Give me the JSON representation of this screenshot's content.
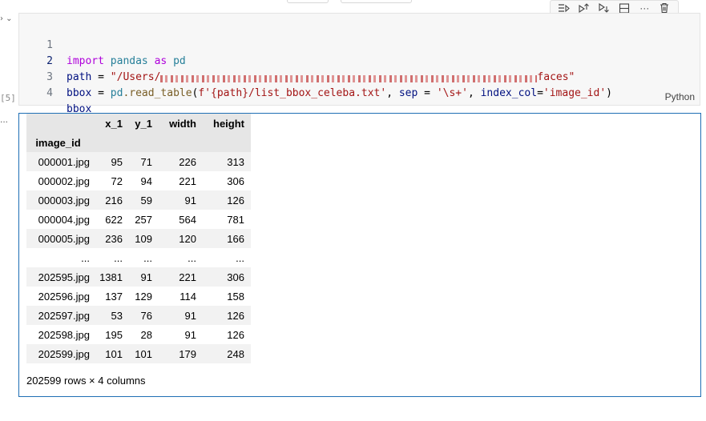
{
  "gutter": {
    "chevrons": "› ⌄",
    "execution_count": "[5]",
    "output_indicator": "..."
  },
  "cell_toolbar": {
    "icons": [
      "run-by-line-icon",
      "execute-above-icon",
      "execute-below-icon",
      "split-cell-icon",
      "more-icon",
      "delete-icon"
    ],
    "more_label": "···"
  },
  "code_cell": {
    "language": "Python",
    "lines": [
      {
        "number": "1",
        "import_kw": "import",
        "module": "pandas",
        "as_kw": "as",
        "alias": "pd"
      },
      {
        "number": "2",
        "var": "path",
        "op": " = ",
        "str_start": "\"/Users/",
        "str_end": "faces\""
      },
      {
        "number": "3",
        "var": "bbox",
        "op": " = ",
        "mod": "pd",
        "fn": ".read_table",
        "paren_open": "(",
        "fstr": "f'{path}/list_bbox_celeba.txt'",
        "sep_txt": ", ",
        "sep_kw": "sep",
        "sep_eq": " = ",
        "sep_val": "'\\s+'",
        "comma2": ", ",
        "index_kw": "index_col",
        "index_eq": "=",
        "index_val": "'image_id'",
        "paren_close": ")"
      },
      {
        "number": "4",
        "var": "bbox"
      }
    ]
  },
  "dataframe": {
    "index_name": "image_id",
    "columns": [
      "x_1",
      "y_1",
      "width",
      "height"
    ],
    "rows": [
      {
        "index": "000001.jpg",
        "values": [
          "95",
          "71",
          "226",
          "313"
        ]
      },
      {
        "index": "000002.jpg",
        "values": [
          "72",
          "94",
          "221",
          "306"
        ]
      },
      {
        "index": "000003.jpg",
        "values": [
          "216",
          "59",
          "91",
          "126"
        ]
      },
      {
        "index": "000004.jpg",
        "values": [
          "622",
          "257",
          "564",
          "781"
        ]
      },
      {
        "index": "000005.jpg",
        "values": [
          "236",
          "109",
          "120",
          "166"
        ]
      },
      {
        "index": "...",
        "values": [
          "...",
          "...",
          "...",
          "..."
        ]
      },
      {
        "index": "202595.jpg",
        "values": [
          "1381",
          "91",
          "221",
          "306"
        ]
      },
      {
        "index": "202596.jpg",
        "values": [
          "137",
          "129",
          "114",
          "158"
        ]
      },
      {
        "index": "202597.jpg",
        "values": [
          "53",
          "76",
          "91",
          "126"
        ]
      },
      {
        "index": "202598.jpg",
        "values": [
          "195",
          "28",
          "91",
          "126"
        ]
      },
      {
        "index": "202599.jpg",
        "values": [
          "101",
          "101",
          "179",
          "248"
        ]
      }
    ],
    "summary": "202599 rows × 4 columns"
  },
  "colors": {
    "output_border": "#1f6fb4",
    "string": "#a31515",
    "keyword": "#af00db",
    "variable": "#001080",
    "module": "#267f99",
    "function": "#795e26"
  }
}
